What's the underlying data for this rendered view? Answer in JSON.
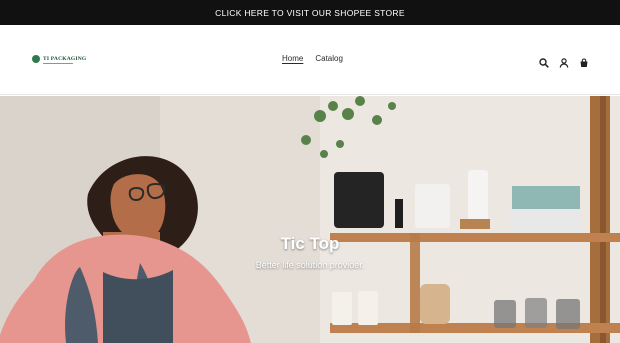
{
  "announcement": {
    "text": "CLICK HERE TO VISIT OUR SHOPEE STORE"
  },
  "logo": {
    "text": "TI PACKAGING"
  },
  "nav": {
    "items": [
      {
        "label": "Home"
      },
      {
        "label": "Catalog"
      }
    ]
  },
  "icons": [
    "search-icon",
    "account-icon",
    "cart-icon"
  ],
  "hero": {
    "title": "Tic Top",
    "subtitle": "Better life solution provider."
  },
  "colors": {
    "announcement_bg": "#111111",
    "logo_green": "#2f7a4c",
    "hero_text": "#ffffff"
  }
}
